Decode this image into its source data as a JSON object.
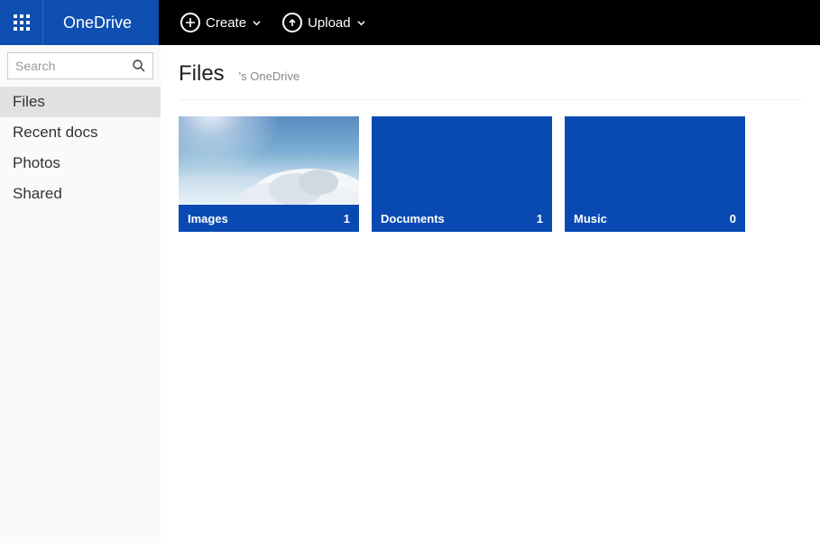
{
  "header": {
    "brand": "OneDrive",
    "create_label": "Create",
    "upload_label": "Upload"
  },
  "sidebar": {
    "search_placeholder": "Search",
    "items": [
      {
        "label": "Files",
        "active": true
      },
      {
        "label": "Recent docs",
        "active": false
      },
      {
        "label": "Photos",
        "active": false
      },
      {
        "label": "Shared",
        "active": false
      }
    ]
  },
  "main": {
    "title": "Files",
    "breadcrumb_user": "",
    "breadcrumb_suffix": "'s OneDrive",
    "folders": [
      {
        "name": "Images",
        "count": 1,
        "thumb": "sky"
      },
      {
        "name": "Documents",
        "count": 1,
        "thumb": "solid"
      },
      {
        "name": "Music",
        "count": 0,
        "thumb": "solid"
      }
    ]
  }
}
